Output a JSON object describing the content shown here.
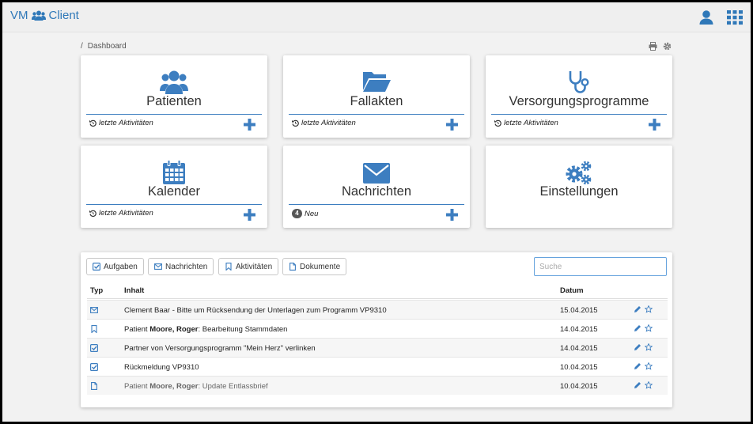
{
  "app": {
    "title_left": "VM",
    "title_right": "Client"
  },
  "colors": {
    "accent": "#3d7ec0",
    "brand": "#2f78b8"
  },
  "breadcrumb": {
    "separator": "/",
    "current": "Dashboard"
  },
  "tiles": [
    {
      "title": "Patienten",
      "icon": "users-icon",
      "footer": "letzte Aktivitäten"
    },
    {
      "title": "Fallakten",
      "icon": "folder-open-icon",
      "footer": "letzte Aktivitäten"
    },
    {
      "title": "Versorgungsprogramme",
      "icon": "stethoscope-icon",
      "footer": "letzte Aktivitäten"
    },
    {
      "title": "Kalender",
      "icon": "calendar-icon",
      "footer": "letzte Aktivitäten"
    },
    {
      "title": "Nachrichten",
      "icon": "envelope-icon",
      "footer": "Neu",
      "badge": "4"
    },
    {
      "title": "Einstellungen",
      "icon": "gears-icon"
    }
  ],
  "panel": {
    "tabs": [
      {
        "label": "Aufgaben",
        "icon": "check-square-icon"
      },
      {
        "label": "Nachrichten",
        "icon": "envelope-icon"
      },
      {
        "label": "Aktivitäten",
        "icon": "bookmark-icon"
      },
      {
        "label": "Dokumente",
        "icon": "file-icon"
      }
    ],
    "search_placeholder": "Suche",
    "columns": {
      "typ": "Typ",
      "inhalt": "Inhalt",
      "datum": "Datum"
    },
    "rows": [
      {
        "icon": "envelope-icon",
        "pre": "Clement Baar - Bitte um Rücksendung der Unterlagen zum Programm VP9310",
        "bold": "",
        "post": "",
        "date": "15.04.2015"
      },
      {
        "icon": "bookmark-icon",
        "pre": "Patient ",
        "bold": "Moore, Roger",
        "post": ": Bearbeitung Stammdaten",
        "date": "14.04.2015"
      },
      {
        "icon": "check-square-icon",
        "pre": "Partner von Versorgungsprogramm \"Mein Herz\" verlinken",
        "bold": "",
        "post": "",
        "date": "14.04.2015"
      },
      {
        "icon": "check-square-icon",
        "pre": "Rückmeldung VP9310",
        "bold": "",
        "post": "",
        "date": "10.04.2015"
      },
      {
        "icon": "file-icon",
        "pre": "Patient ",
        "bold": "Moore, Roger",
        "post": ": Update Entlassbrief",
        "date": "10.04.2015"
      }
    ]
  }
}
